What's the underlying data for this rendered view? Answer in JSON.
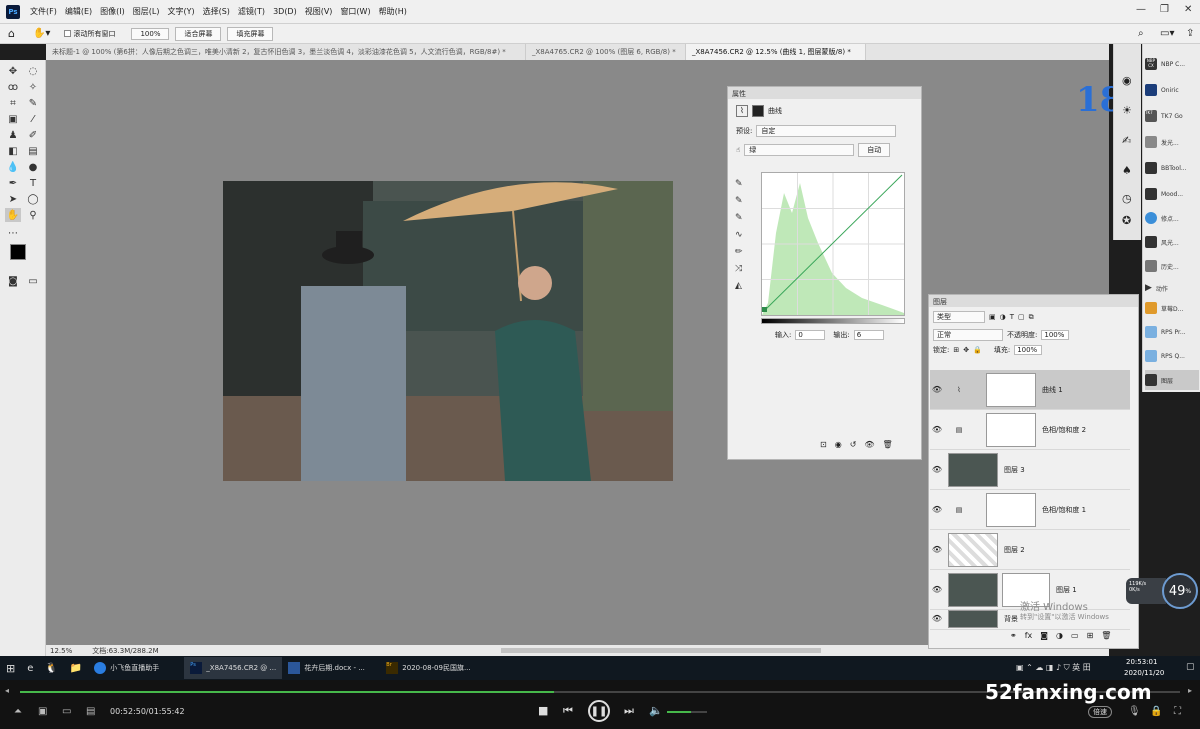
{
  "menu": [
    "文件(F)",
    "编辑(E)",
    "图像(I)",
    "图层(L)",
    "文字(Y)",
    "选择(S)",
    "滤镜(T)",
    "3D(D)",
    "视图(V)",
    "窗口(W)",
    "帮助(H)"
  ],
  "app_logo": "Ps",
  "options": {
    "scroll_all": "滚动所有窗口",
    "zoom": "100%",
    "fit_screen": "适合屏幕",
    "fill_screen": "填充屏幕"
  },
  "tabs": [
    {
      "label": "未标题-1 @ 100% (第6拼：人像后期之色调三，唯美小清新 2，复古怀旧色调 3，墨兰淡色调 4，淡彩油漆花色调 5，人文流行色调，RGB/8#) *",
      "active": false
    },
    {
      "label": "_X8A4765.CR2 @ 100% (图层 6, RGB/8) *",
      "active": false
    },
    {
      "label": "_X8A7456.CR2 @ 12.5% (曲线 1, 图层蒙版/8) *",
      "active": true
    }
  ],
  "status": {
    "zoom": "12.5%",
    "doc": "文档:63.3M/288.2M"
  },
  "properties": {
    "panel_title": "属性",
    "type_label": "曲线",
    "preset_label": "预设:",
    "preset_value": "自定",
    "channel_value": "绿",
    "auto_btn": "自动",
    "input_label": "输入:",
    "input_value": "0",
    "output_label": "输出:",
    "output_value": "6"
  },
  "layers": {
    "panel_title": "图层",
    "filter": "类型",
    "blend_mode": "正常",
    "opacity_label": "不透明度:",
    "opacity_value": "100%",
    "lock_label": "锁定:",
    "fill_label": "填充:",
    "fill_value": "100%",
    "items": [
      {
        "name": "曲线 1",
        "selected": true
      },
      {
        "name": "色相/饱和度 2",
        "selected": false
      },
      {
        "name": "图层 3",
        "selected": false
      },
      {
        "name": "色相/饱和度 1",
        "selected": false
      },
      {
        "name": "图层 2",
        "selected": false
      },
      {
        "name": "图层 1",
        "selected": false
      },
      {
        "name": "背景",
        "selected": false
      }
    ]
  },
  "activate": {
    "title": "激活 Windows",
    "sub": "转到\"设置\"以激活 Windows"
  },
  "gauge": {
    "percent": "49",
    "unit": "%",
    "up": "119K/s",
    "down": "0K/s"
  },
  "plugins": [
    "NBP C...",
    "Oniric",
    "TK7 Go",
    "发光...",
    "BBTool...",
    "Mood...",
    "修点...",
    "风光...",
    "历史...",
    "动作",
    "草莓D...",
    "RPS Pr...",
    "RPS Q...",
    "图层"
  ],
  "plugin_logos": [
    "NBP CX",
    "TK7"
  ],
  "taskbar": {
    "items": [
      "小飞鱼直播助手",
      "_X8A7456.CR2 @ ...",
      "花卉后期.docx - ...",
      "2020-08-09民国旗..."
    ],
    "time": "20:53:01",
    "date": "2020/11/20",
    "ps_label": "Ps",
    "br_label": "Br"
  },
  "player": {
    "time": "00:52:50/01:55:42",
    "speed": "倍速",
    "progress": 0.46,
    "volume": 0.6
  },
  "watermark": "52fanxing.com",
  "logo": "18"
}
